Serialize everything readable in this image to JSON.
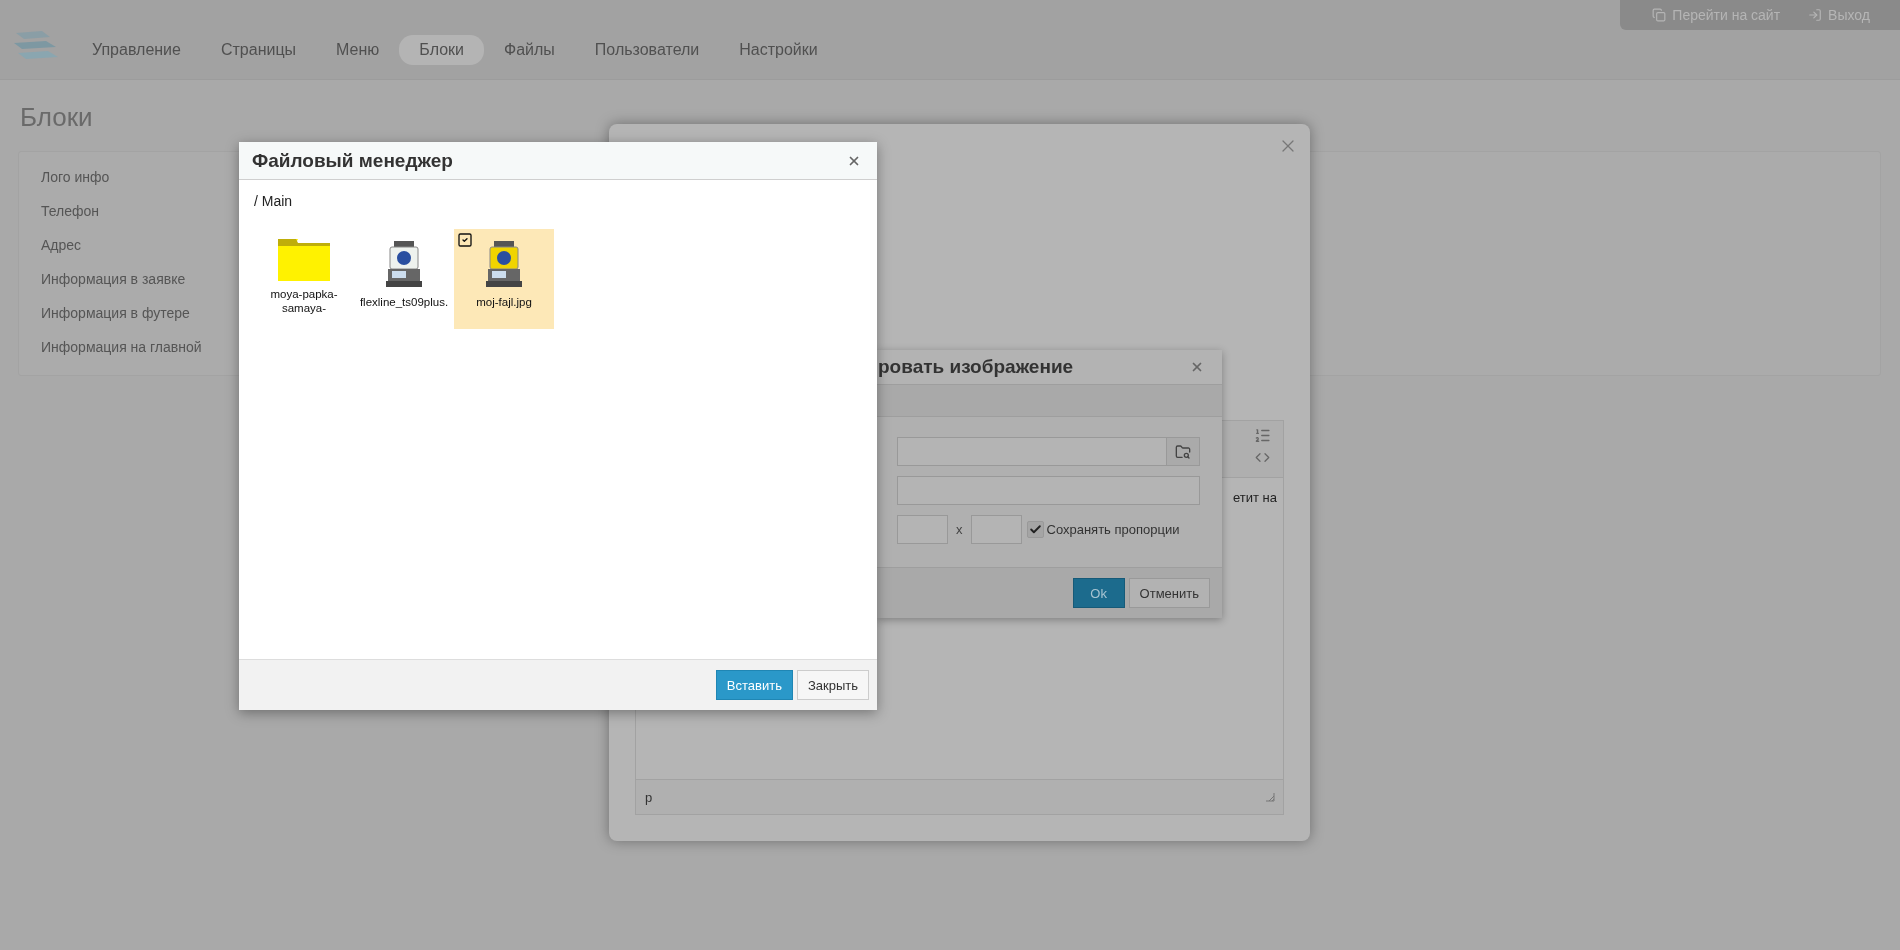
{
  "topbar": {
    "links": [
      {
        "label": "Перейти на сайт"
      },
      {
        "label": "Выход"
      }
    ]
  },
  "nav": [
    {
      "label": "Управление",
      "selected": false
    },
    {
      "label": "Страницы",
      "selected": false
    },
    {
      "label": "Меню",
      "selected": false
    },
    {
      "label": "Блоки",
      "selected": true
    },
    {
      "label": "Файлы",
      "selected": false
    },
    {
      "label": "Пользователи",
      "selected": false
    },
    {
      "label": "Настройки",
      "selected": false
    }
  ],
  "page": {
    "title": "Блоки",
    "blocks": [
      "Лого инфо",
      "Телефон",
      "Адрес",
      "Информация в заявке",
      "Информация в футере",
      "Информация на главной"
    ]
  },
  "edit_modal": {
    "editor": {
      "text": "етит на",
      "status": "p"
    }
  },
  "image_dialog": {
    "title": "ровать изображение",
    "size_separator": "x",
    "keep_proportions": {
      "label": "Сохранять пропорции",
      "checked": true
    },
    "buttons": [
      "Ok",
      "Отменить"
    ]
  },
  "file_manager": {
    "title": "Файловый менеджер",
    "path": "/ Main",
    "files": [
      {
        "name": "moya-papka-samaya-",
        "kind": "folder",
        "selected": false
      },
      {
        "name": "flexline_ts09plus.",
        "kind": "image",
        "selected": false
      },
      {
        "name": "moj-fajl.jpg",
        "kind": "image",
        "selected": true
      }
    ],
    "buttons": [
      "Вставить",
      "Закрыть"
    ]
  }
}
